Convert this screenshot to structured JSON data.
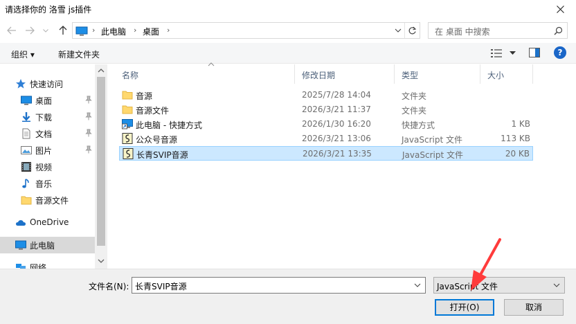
{
  "window": {
    "title": "请选择你的 洛雪 js插件"
  },
  "address": {
    "crumbs": [
      "此电脑",
      "桌面"
    ],
    "search_placeholder": "在 桌面 中搜索"
  },
  "toolbar": {
    "organize": "组织 ▾",
    "new_folder": "新建文件夹"
  },
  "nav": {
    "items": [
      {
        "label": "快速访问",
        "icon": "star-icon"
      },
      {
        "label": "桌面",
        "icon": "desktop-icon",
        "pinned": true
      },
      {
        "label": "下载",
        "icon": "download-icon",
        "pinned": true
      },
      {
        "label": "文档",
        "icon": "document-icon",
        "pinned": true
      },
      {
        "label": "图片",
        "icon": "picture-icon",
        "pinned": true
      },
      {
        "label": "视频",
        "icon": "video-icon"
      },
      {
        "label": "音乐",
        "icon": "music-icon"
      },
      {
        "label": "音源文件",
        "icon": "folder-icon"
      },
      {
        "label": "OneDrive",
        "icon": "cloud-icon"
      },
      {
        "label": "此电脑",
        "icon": "computer-icon",
        "selected": true
      },
      {
        "label": "网络",
        "icon": "network-icon"
      }
    ]
  },
  "files": {
    "columns": {
      "name": "名称",
      "date": "修改日期",
      "type": "类型",
      "size": "大小"
    },
    "rows": [
      {
        "name": "音源",
        "date": "2025/7/28 14:04",
        "type": "文件夹",
        "size": "",
        "icon": "folder-icon"
      },
      {
        "name": "音源文件",
        "date": "2026/3/21 11:37",
        "type": "文件夹",
        "size": "",
        "icon": "folder-icon"
      },
      {
        "name": "此电脑 - 快捷方式",
        "date": "2026/1/30 16:20",
        "type": "快捷方式",
        "size": "1 KB",
        "icon": "shortcut-icon"
      },
      {
        "name": "公众号音源",
        "date": "2026/3/21 13:06",
        "type": "JavaScript 文件",
        "size": "113 KB",
        "icon": "script-file-icon"
      },
      {
        "name": "长青SVIP音源",
        "date": "2026/3/21 13:35",
        "type": "JavaScript 文件",
        "size": "20 KB",
        "icon": "script-file-icon",
        "selected": true
      }
    ]
  },
  "bottom": {
    "filename_label": "文件名(N):",
    "filename_value": "长青SVIP音源",
    "filetype_value": "JavaScript 文件",
    "open_button": "打开(O)",
    "cancel_button": "取消"
  },
  "colors": {
    "accent": "#0078d7",
    "selection": "#cce8ff",
    "folder": "#ffd86e",
    "annotation_arrow": "#ff3b3b"
  }
}
